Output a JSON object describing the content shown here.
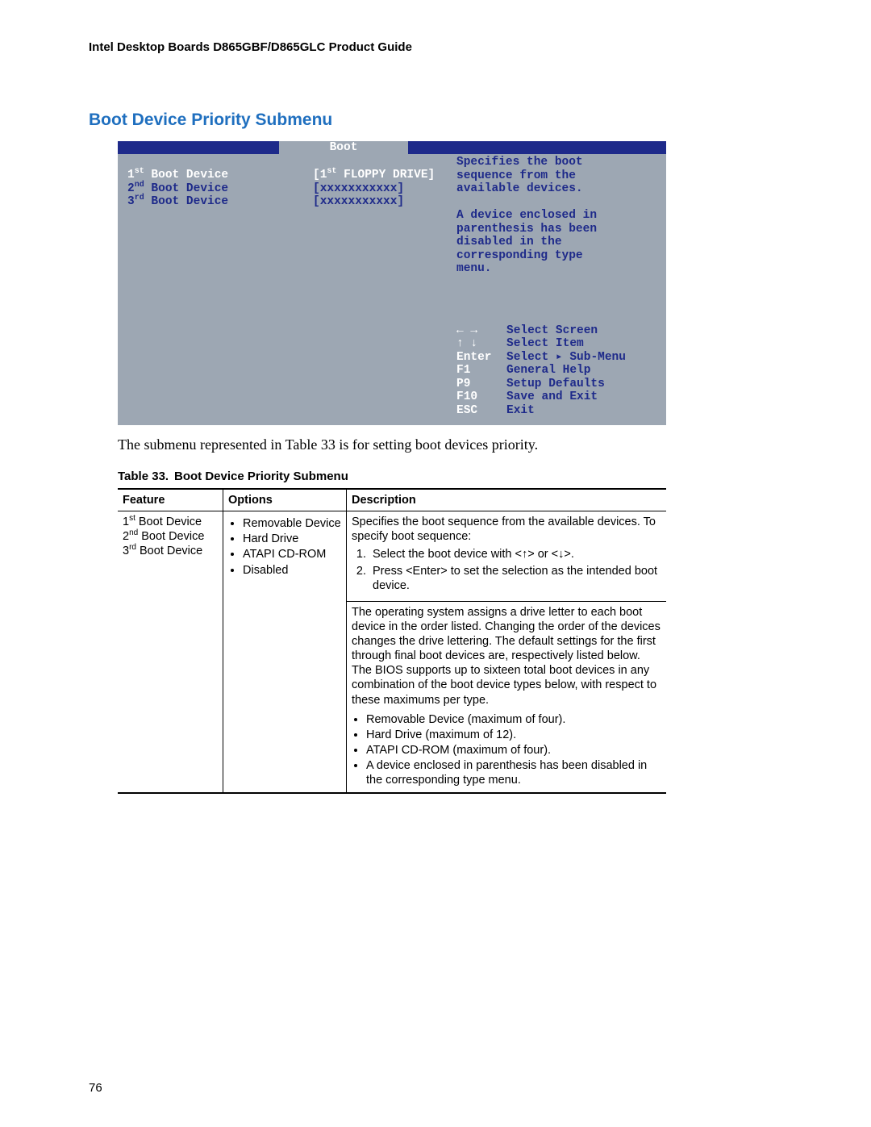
{
  "doc_title": "Intel Desktop Boards D865GBF/D865GLC Product Guide",
  "section_heading": "Boot Device Priority Submenu",
  "bios": {
    "tab": "Boot",
    "rows": [
      {
        "ord": "1",
        "sup": "st",
        "label": " Boot Device",
        "value": "[1",
        "value_sup": "st",
        "value_rest": " FLOPPY DRIVE]",
        "white_value": true
      },
      {
        "ord": "2",
        "sup": "nd",
        "label": " Boot Device",
        "value": "[xxxxxxxxxxx]"
      },
      {
        "ord": "3",
        "sup": "rd",
        "label": " Boot Device",
        "value": "[xxxxxxxxxxx]"
      }
    ],
    "help": [
      "Specifies the boot",
      "sequence from the",
      "available devices.",
      "",
      "A device enclosed in",
      "parenthesis has been",
      "disabled in the",
      "corresponding type",
      "menu."
    ],
    "nav": [
      {
        "key": "← →",
        "desc": "Select Screen"
      },
      {
        "key": "↑ ↓",
        "desc": "Select Item"
      },
      {
        "key": "Enter",
        "desc": "Select ▸ Sub-Menu"
      },
      {
        "key": "F1",
        "desc": "General Help"
      },
      {
        "key": "P9",
        "desc": "Setup Defaults"
      },
      {
        "key": "F10",
        "desc": "Save and Exit"
      },
      {
        "key": "ESC",
        "desc": "Exit"
      }
    ]
  },
  "body_text": "The submenu represented in Table 33 is for setting boot devices priority.",
  "table_caption_num": "Table 33.",
  "table_caption_title": "Boot Device Priority Submenu",
  "table": {
    "headers": [
      "Feature",
      "Options",
      "Description"
    ],
    "features": [
      {
        "pre": "1",
        "sup": "st",
        "post": " Boot Device"
      },
      {
        "pre": "2",
        "sup": "nd",
        "post": " Boot Device"
      },
      {
        "pre": "3",
        "sup": "rd",
        "post": " Boot Device"
      }
    ],
    "options": [
      "Removable Device",
      "Hard Drive",
      "ATAPI CD-ROM",
      "Disabled"
    ],
    "desc1_intro": "Specifies the boot sequence from the available devices.  To specify boot sequence:",
    "desc1_steps": [
      "Select the boot device with <↑> or <↓>.",
      "Press <Enter> to set the selection as the intended boot device."
    ],
    "desc2_para": "The operating system assigns a drive letter to each boot device in the order listed.  Changing the order of the devices changes the drive lettering.  The default settings for the first through final boot devices are, respectively listed below.  The BIOS supports up to sixteen total boot devices in any combination of the boot device types below, with respect to these maximums per type.",
    "desc2_bullets": [
      "Removable Device (maximum of four).",
      "Hard Drive (maximum of 12).",
      "ATAPI CD-ROM (maximum of four).",
      "A device enclosed in parenthesis has been disabled in the corresponding type menu."
    ]
  },
  "page_number": "76"
}
